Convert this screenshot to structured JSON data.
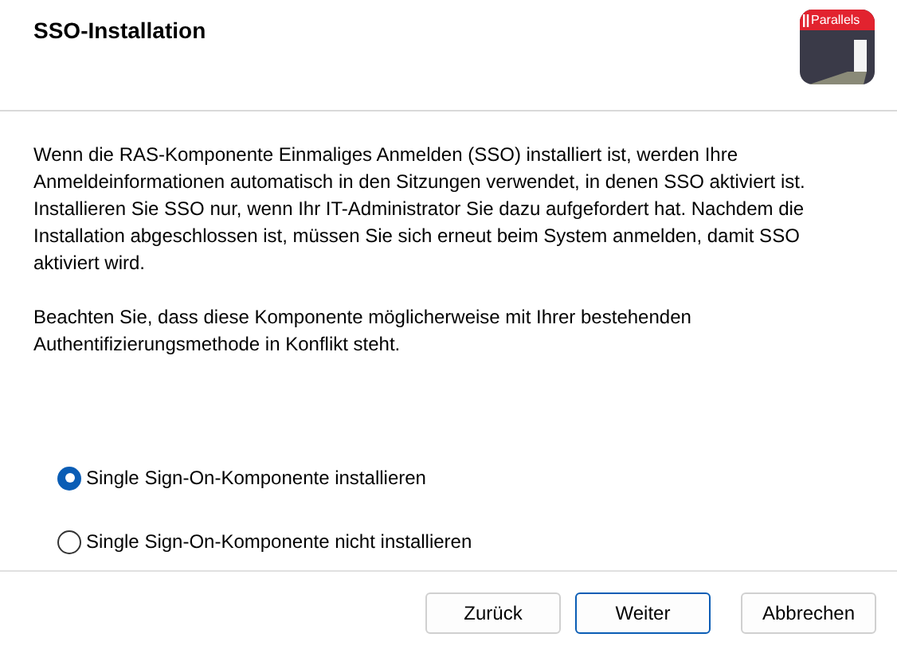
{
  "header": {
    "title": "SSO-Installation",
    "logo_text": "Parallels"
  },
  "paragraphs": [
    "Wenn die RAS-Komponente Einmaliges Anmelden (SSO) installiert ist, werden Ihre Anmeldeinformationen automatisch in den Sitzungen verwendet, in denen SSO aktiviert ist. Installieren Sie SSO nur, wenn Ihr IT-Administrator Sie dazu aufgefordert hat. Nachdem die Installation abgeschlossen ist, müssen Sie sich erneut beim System anmelden, damit SSO aktiviert wird.",
    "Beachten Sie, dass diese Komponente möglicherweise mit Ihrer bestehenden Authentifizierungsmethode in Konflikt steht."
  ],
  "options": [
    {
      "label": "Single Sign-On-Komponente installieren",
      "selected": true
    },
    {
      "label": "Single Sign-On-Komponente nicht installieren",
      "selected": false
    }
  ],
  "buttons": [
    {
      "label": "Zurück",
      "default": false
    },
    {
      "label": "Weiter",
      "default": true
    },
    {
      "label": "Abbrechen",
      "default": false
    }
  ]
}
